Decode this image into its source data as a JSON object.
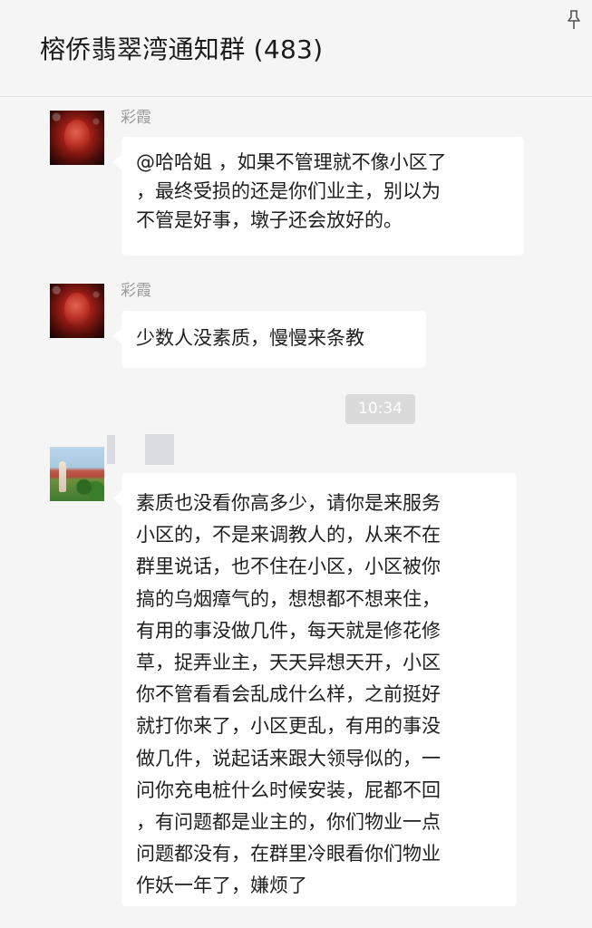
{
  "header": {
    "title": "榕侨翡翠湾通知群 (483)",
    "pin_icon": "pin-icon"
  },
  "messages": [
    {
      "sender": "彩霞",
      "avatar": "avatar-red-flower",
      "lines": [
        "@哈哈姐 ，如果不管理就不像小区了",
        "，最终受损的还是你们业主，别以为",
        "不管是好事，墩子还会放好的。"
      ]
    },
    {
      "sender": "彩霞",
      "avatar": "avatar-red-flower",
      "lines": [
        "少数人没素质，慢慢来条教"
      ]
    },
    {
      "sender": "",
      "avatar": "avatar-landscape",
      "lines": [
        "素质也没看你高多少，请你是来服务",
        "小区的，不是来调教人的，从来不在",
        "群里说话，也不住在小区，小区被你",
        "搞的乌烟瘴气的，想想都不想来住，",
        "有用的事没做几件，每天就是修花修",
        "草，捉弄业主，天天异想天开，小区",
        "你不管看看会乱成什么样，之前挺好",
        "就打你来了，小区更乱，有用的事没",
        "做几件，说起话来跟大领导似的，一",
        "问你充电桩什么时候安装，屁都不回",
        "，有问题都是业主的，你们物业一点",
        "问题都没有，在群里冷眼看你们物业",
        "作妖一年了，嫌烦了"
      ]
    }
  ],
  "timestamp": "10:34"
}
